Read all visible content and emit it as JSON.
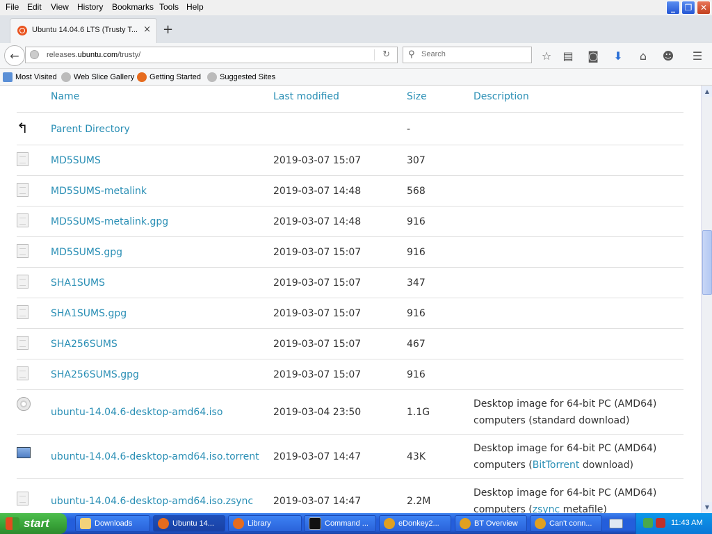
{
  "menu": [
    "File",
    "Edit",
    "View",
    "History",
    "Bookmarks",
    "Tools",
    "Help"
  ],
  "tab": {
    "title": "Ubuntu 14.04.6 LTS (Trusty T...",
    "close": "×"
  },
  "newtab": "+",
  "urlbar": {
    "domain_pre": "releases.",
    "domain_main": "ubuntu.com",
    "path": "/trusty/"
  },
  "search": {
    "placeholder": "Search"
  },
  "bookmarks": [
    "Most Visited",
    "Web Slice Gallery",
    "Getting Started",
    "Suggested Sites"
  ],
  "table": {
    "headers": {
      "name": "Name",
      "modified": "Last modified",
      "size": "Size",
      "description": "Description"
    },
    "parent": {
      "name": "Parent Directory",
      "size": "-"
    },
    "rows": [
      {
        "name": "MD5SUMS",
        "date": "2019-03-07 15:07",
        "size": "307"
      },
      {
        "name": "MD5SUMS-metalink",
        "date": "2019-03-07 14:48",
        "size": "568"
      },
      {
        "name": "MD5SUMS-metalink.gpg",
        "date": "2019-03-07 14:48",
        "size": "916"
      },
      {
        "name": "MD5SUMS.gpg",
        "date": "2019-03-07 15:07",
        "size": "916"
      },
      {
        "name": "SHA1SUMS",
        "date": "2019-03-07 15:07",
        "size": "347"
      },
      {
        "name": "SHA1SUMS.gpg",
        "date": "2019-03-07 15:07",
        "size": "916"
      },
      {
        "name": "SHA256SUMS",
        "date": "2019-03-07 15:07",
        "size": "467"
      },
      {
        "name": "SHA256SUMS.gpg",
        "date": "2019-03-07 15:07",
        "size": "916"
      }
    ],
    "iso_rows": [
      {
        "name": "ubuntu-14.04.6-desktop-amd64.iso",
        "date": "2019-03-04 23:50",
        "size": "1.1G",
        "desc1": "Desktop image for 64-bit PC (AMD64)",
        "desc2_pre": "computers (standard download)",
        "desc2_link": "",
        "desc2_post": ""
      },
      {
        "name": "ubuntu-14.04.6-desktop-amd64.iso.torrent",
        "date": "2019-03-07 14:47",
        "size": "43K",
        "desc1": "Desktop image for 64-bit PC (AMD64)",
        "desc2_pre": "computers (",
        "desc2_link": "BitTorrent",
        "desc2_post": " download)"
      },
      {
        "name": "ubuntu-14.04.6-desktop-amd64.iso.zsync",
        "date": "2019-03-07 14:47",
        "size": "2.2M",
        "desc1": "Desktop image for 64-bit PC (AMD64)",
        "desc2_pre": "computers (",
        "desc2_link": "zsync",
        "desc2_post": " metafile)"
      }
    ]
  },
  "taskbar": {
    "start": "start",
    "buttons": [
      "Downloads",
      "Ubuntu 14...",
      "Library",
      "Command ...",
      "eDonkey2...",
      "BT Overview",
      "Can't conn..."
    ],
    "clock": "11:43 AM"
  },
  "colors": {
    "link": "#2a8fb5",
    "header": "#19b6ee",
    "taskbar": "#245edb"
  }
}
